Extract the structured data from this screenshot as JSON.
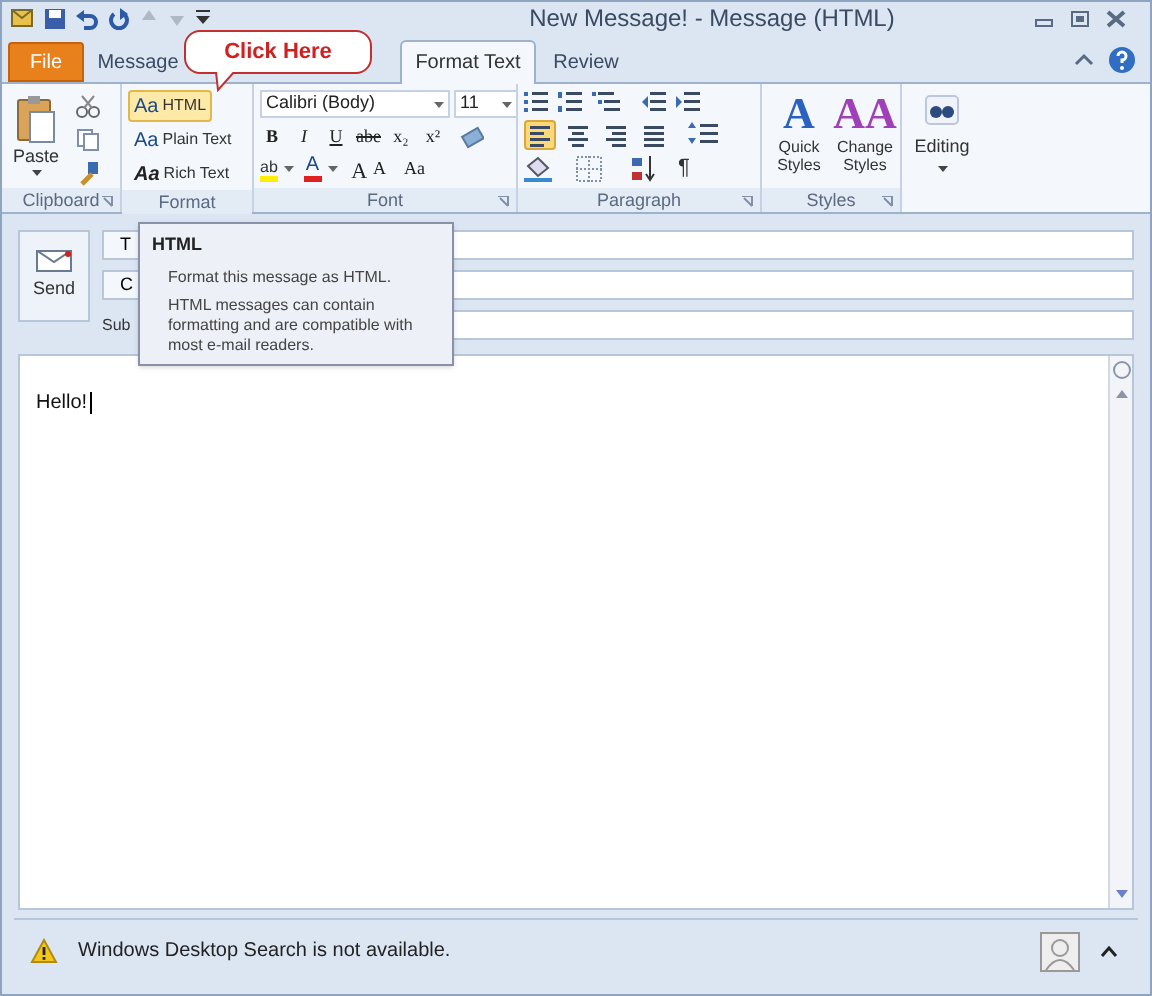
{
  "window": {
    "title": "New Message! - Message (HTML)"
  },
  "tabs": [
    {
      "label": "File",
      "kind": "file",
      "selected": false
    },
    {
      "label": "Message",
      "kind": "tab",
      "selected": false
    },
    {
      "label": "Format Text",
      "kind": "tab",
      "selected": true
    },
    {
      "label": "Review",
      "kind": "tab",
      "selected": false
    }
  ],
  "callout": {
    "text": "Click Here"
  },
  "clipboard": {
    "paste": "Paste",
    "label": "Clipboard"
  },
  "format": {
    "label": "Format",
    "items": [
      {
        "icon_text": "Aa",
        "label": "HTML",
        "selected": true
      },
      {
        "icon_text": "Aa",
        "label": "Plain Text",
        "selected": false
      },
      {
        "icon_text": "Aa",
        "label": "Rich Text",
        "selected": false
      }
    ]
  },
  "font": {
    "label": "Font",
    "name": "Calibri (Body)",
    "size": "11",
    "style_buttons": [
      "B",
      "I",
      "U",
      "abe",
      "x₂",
      "x²"
    ],
    "highlight": "ab",
    "color_button": "A",
    "size_buttons": [
      "A",
      "A",
      "Aa"
    ]
  },
  "paragraph": {
    "label": "Paragraph",
    "align": [
      {
        "selected": true
      },
      {
        "selected": false
      },
      {
        "selected": false
      },
      {
        "selected": false
      }
    ],
    "pilcrow": "¶"
  },
  "styles": {
    "label": "Styles",
    "quick": {
      "icon_text": "A",
      "label": "Quick Styles"
    },
    "change": {
      "icon_text": "AA",
      "label": "Change Styles"
    }
  },
  "editing": {
    "label": "Editing"
  },
  "tooltip": {
    "title": "HTML",
    "lines": [
      "Format this message as HTML.",
      "HTML messages can contain formatting and are compatible with most e-mail readers."
    ]
  },
  "header": {
    "send": "Send",
    "fields": [
      "T",
      "C",
      "Sub"
    ]
  },
  "body": {
    "text": "Hello!"
  },
  "status": {
    "text": "Windows Desktop Search is not available."
  }
}
